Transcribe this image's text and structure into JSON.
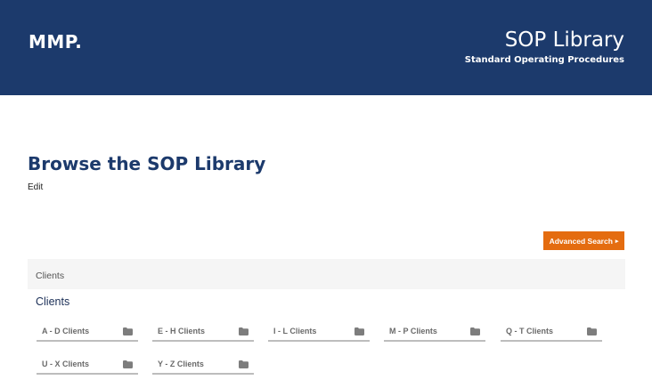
{
  "header": {
    "logo": "MMP.",
    "title": "SOP Library",
    "subtitle": "Standard Operating Procedures"
  },
  "main": {
    "title": "Browse the SOP Library",
    "edit_label": "Edit",
    "advanced_search_label": "Advanced Search"
  },
  "section": {
    "bar_label": "Clients",
    "heading": "Clients",
    "folders": [
      {
        "label": "A - D Clients",
        "icon": "folder-icon"
      },
      {
        "label": "E - H Clients",
        "icon": "folder-icon"
      },
      {
        "label": "I - L Clients",
        "icon": "folder-icon"
      },
      {
        "label": "M - P Clients",
        "icon": "folder-icon"
      },
      {
        "label": "Q - T Clients",
        "icon": "folder-icon"
      },
      {
        "label": "U - X Clients",
        "icon": "folder-icon"
      },
      {
        "label": "Y - Z Clients",
        "icon": "folder-icon"
      }
    ]
  },
  "colors": {
    "header_bg": "#1c3a6c",
    "accent": "#e46c10"
  }
}
